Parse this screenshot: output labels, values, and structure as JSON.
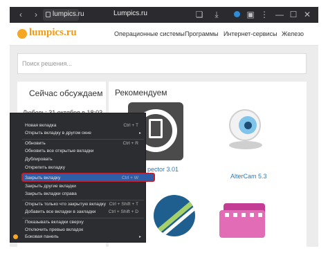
{
  "browser": {
    "url": "lumpics.ru",
    "title": "Lumpics.ru"
  },
  "site": {
    "logo": "lumpics.ru",
    "nav": [
      "Операционные системы",
      "Программы",
      "Интернет-сервисы",
      "Железо"
    ],
    "search_placeholder": "Поиск решения...",
    "discuss_title": "Сейчас обсуждаем",
    "discuss_item": "Любовь: 31 октября в 18:03",
    "recommend_title": "Рекомендуем",
    "app_name_1": "pector 3.01",
    "app_name_2": "AlterCam 5.3"
  },
  "menu": {
    "items": [
      {
        "label": "Новая вкладка",
        "shortcut": "Ctrl + T"
      },
      {
        "label": "Открыть вкладку в другом окне",
        "shortcut": "▸"
      },
      {
        "label": "Обновить",
        "shortcut": "Ctrl + R"
      },
      {
        "label": "Обновить все открытые вкладки",
        "shortcut": ""
      },
      {
        "label": "Дублировать",
        "shortcut": ""
      },
      {
        "label": "Открепить вкладку",
        "shortcut": ""
      },
      {
        "label": "Закрыть вкладку",
        "shortcut": "Ctrl + W"
      },
      {
        "label": "Закрыть другие вкладки",
        "shortcut": ""
      },
      {
        "label": "Закрыть вкладки справа",
        "shortcut": ""
      },
      {
        "label": "Открыть только что закрытую вкладку",
        "shortcut": "Ctrl + Shift + T"
      },
      {
        "label": "Добавить все вкладки в закладки",
        "shortcut": "Ctrl + Shift + D"
      },
      {
        "label": "Показывать вкладки сверху",
        "shortcut": ""
      },
      {
        "label": "Отключить превью вкладок",
        "shortcut": ""
      },
      {
        "label": "Боковая панель",
        "shortcut": "▸"
      }
    ]
  },
  "colors": {
    "accent": "#f09a1a",
    "link": "#2a7ab8",
    "menu_bg": "#2c2d31",
    "highlight": "#2f5ea8",
    "highlight_border": "#c41f2a"
  },
  "icons": [
    "back-icon",
    "forward-icon",
    "lock-icon",
    "bookmark-icon",
    "download-icon",
    "extension-icon",
    "more-icon",
    "minimize-icon",
    "maximize-icon",
    "close-icon"
  ]
}
